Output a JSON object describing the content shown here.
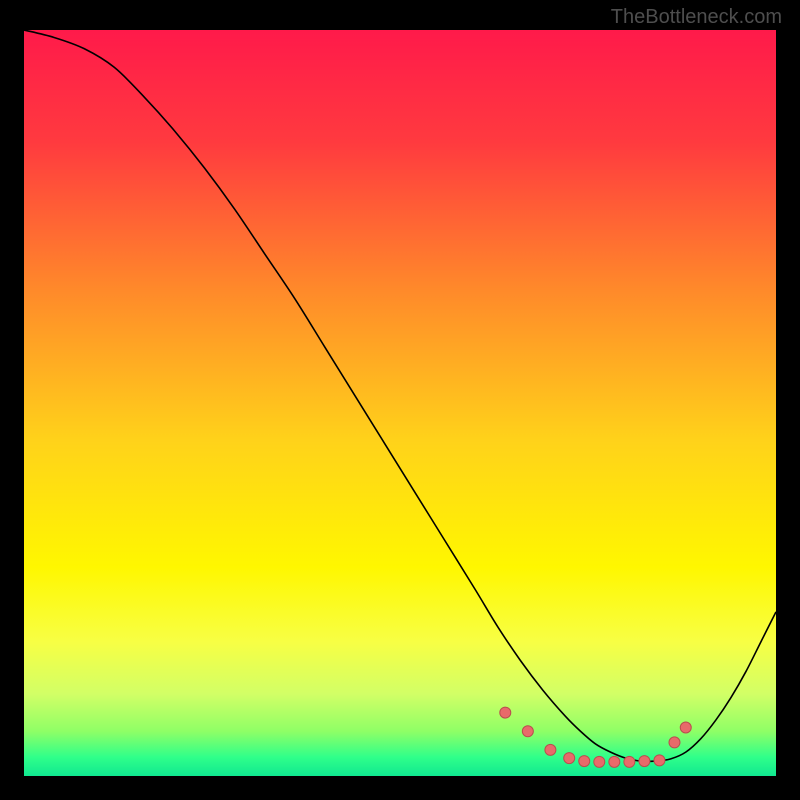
{
  "attribution": "TheBottleneck.com",
  "chart_data": {
    "type": "line",
    "title": "",
    "xlabel": "",
    "ylabel": "",
    "xlim": [
      0,
      100
    ],
    "ylim": [
      0,
      100
    ],
    "grid": false,
    "legend": false,
    "background_gradient": {
      "stops": [
        {
          "offset": 0.0,
          "color": "#ff1a4a"
        },
        {
          "offset": 0.15,
          "color": "#ff3a3f"
        },
        {
          "offset": 0.35,
          "color": "#ff8a2a"
        },
        {
          "offset": 0.55,
          "color": "#ffd21a"
        },
        {
          "offset": 0.72,
          "color": "#fff700"
        },
        {
          "offset": 0.82,
          "color": "#f7ff44"
        },
        {
          "offset": 0.89,
          "color": "#d2ff66"
        },
        {
          "offset": 0.94,
          "color": "#8fff66"
        },
        {
          "offset": 0.975,
          "color": "#2fff8a"
        },
        {
          "offset": 1.0,
          "color": "#10e890"
        }
      ]
    },
    "series": [
      {
        "name": "bottleneck-curve",
        "stroke": "#000000",
        "strokeWidth": 1.6,
        "x": [
          0,
          4,
          8,
          12,
          16,
          20,
          24,
          28,
          32,
          36,
          40,
          44,
          48,
          52,
          56,
          60,
          63,
          66,
          69,
          72,
          74,
          76,
          78,
          80,
          82,
          84,
          86,
          88,
          90,
          92,
          94,
          96,
          98,
          100
        ],
        "y": [
          100,
          99,
          97.5,
          95,
          91,
          86.5,
          81.5,
          76,
          70,
          64,
          57.5,
          51,
          44.5,
          38,
          31.5,
          25,
          20,
          15.5,
          11.5,
          8,
          6,
          4.3,
          3.2,
          2.4,
          2.0,
          2.0,
          2.3,
          3.2,
          5.0,
          7.5,
          10.5,
          14,
          18,
          22
        ]
      }
    ],
    "markers": {
      "name": "bottleneck-cluster",
      "fill": "#e86a6a",
      "stroke": "#b94e4e",
      "radius": 5.5,
      "points": [
        {
          "x": 64,
          "y": 8.5
        },
        {
          "x": 67,
          "y": 6.0
        },
        {
          "x": 70,
          "y": 3.5
        },
        {
          "x": 72.5,
          "y": 2.4
        },
        {
          "x": 74.5,
          "y": 2.0
        },
        {
          "x": 76.5,
          "y": 1.9
        },
        {
          "x": 78.5,
          "y": 1.9
        },
        {
          "x": 80.5,
          "y": 1.9
        },
        {
          "x": 82.5,
          "y": 2.0
        },
        {
          "x": 84.5,
          "y": 2.1
        },
        {
          "x": 86.5,
          "y": 4.5
        },
        {
          "x": 88.0,
          "y": 6.5
        }
      ]
    }
  }
}
